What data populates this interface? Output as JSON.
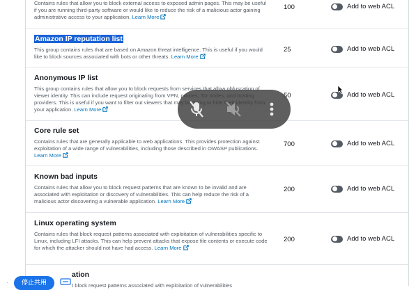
{
  "rows": [
    {
      "title": "",
      "description": "Contains rules that allow you to block external access to exposed admin pages. This may be useful if you are running third-party software or would like to reduce the risk of a malicious actor gaining administrative access to your application.",
      "learn_more": "Learn More",
      "capacity": "100",
      "toggle_label": "Add to web ACL",
      "enabled": false
    },
    {
      "title": "Amazon IP reputation list",
      "description": "This group contains rules that are based on Amazon threat intelligence. This is useful if you would like to block sources associated with bots or other threats.",
      "learn_more": "Learn More",
      "capacity": "25",
      "toggle_label": "Add to web ACL",
      "enabled": false
    },
    {
      "title": "Anonymous IP list",
      "description": "This group contains rules that allow you to block requests from services that allow obfuscation of viewer identity. This can include request originating from VPN, proxies, Tor nodes, and hosting providers. This is useful if you want to filter out viewers that may be trying to hide their identity from your application.",
      "learn_more": "Learn More",
      "capacity": "50",
      "toggle_label": "Add to web ACL",
      "enabled": false
    },
    {
      "title": "Core rule set",
      "description": "Contains rules that are generally applicable to web applications. This provides protection against exploitation of a wide range of vulnerabilities, including those described in OWASP publications.",
      "learn_more": "Learn More",
      "capacity": "700",
      "toggle_label": "Add to web ACL",
      "enabled": false
    },
    {
      "title": "Known bad inputs",
      "description": "Contains rules that allow you to block request patterns that are known to be invalid and are associated with exploitation or discovery of vulnerabilities. This can help reduce the risk of a malicious actor discovering a vulnerable application.",
      "learn_more": "Learn More",
      "capacity": "200",
      "toggle_label": "Add to web ACL",
      "enabled": false
    },
    {
      "title": "Linux operating system",
      "description": "Contains rules that block request patterns associated with exploitation of vulnerabilities specific to Linux, including LFI attacks. This can help prevent attacks that expose file contents or execute code for which the attacker should not have had access.",
      "learn_more": "Learn More",
      "capacity": "200",
      "toggle_label": "Add to web ACL",
      "enabled": false
    }
  ],
  "partial_row": {
    "title": "ation",
    "description": "t block request patterns associated with exploitation of vulnerabilities"
  },
  "overlay": {
    "mic_icon": "mic-off-icon",
    "speaker_icon": "speaker-off-icon",
    "more_icon": "more-vertical-icon"
  },
  "bottom_bar": {
    "stop_share_label": "停止共用",
    "dot": "·"
  },
  "colors": {
    "link": "#0073bb",
    "highlight": "#1a62d6",
    "toggle_off": "#545b64",
    "stop_button": "#1a73e8"
  }
}
